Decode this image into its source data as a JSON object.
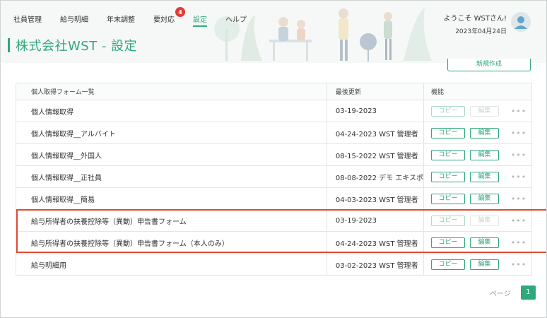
{
  "nav": {
    "items": [
      {
        "label": "社員管理"
      },
      {
        "label": "給与明細"
      },
      {
        "label": "年末調整"
      },
      {
        "label": "要対応",
        "badge": "4"
      },
      {
        "label": "設定",
        "active": true
      },
      {
        "label": "ヘルプ"
      }
    ]
  },
  "user": {
    "welcome": "ようこそ WSTさん!",
    "date": "2023年04月24日"
  },
  "page": {
    "title": "株式会社WST - 設定",
    "new_button": "新規作成"
  },
  "table": {
    "headers": {
      "name": "個人取得フォーム一覧",
      "updated": "最後更新",
      "function": "機能"
    },
    "copy_label": "コピー",
    "edit_label": "編集",
    "more_label": "•••",
    "rows": [
      {
        "name": "個人情報取得",
        "updated": "03-19-2023",
        "edit_disabled": true
      },
      {
        "name": "個人情報取得__アルバイト",
        "updated": "04-24-2023 WST 管理者",
        "edit_disabled": false
      },
      {
        "name": "個人情報取得__外国人",
        "updated": "08-15-2022 WST 管理者",
        "edit_disabled": false
      },
      {
        "name": "個人情報取得__正社員",
        "updated": "08-08-2022 デモ エキスポ",
        "edit_disabled": false
      },
      {
        "name": "個人情報取得__簡易",
        "updated": "04-03-2023 WST 管理者",
        "edit_disabled": false
      },
      {
        "name": "給与所得者の扶養控除等（異動）申告書フォーム",
        "updated": "03-19-2023",
        "edit_disabled": true
      },
      {
        "name": "給与所得者の扶養控除等（異動）申告書フォーム（本人のみ）",
        "updated": "04-24-2023 WST 管理者",
        "edit_disabled": false
      },
      {
        "name": "給与明細用",
        "updated": "03-02-2023 WST 管理者",
        "edit_disabled": false
      }
    ]
  },
  "pager": {
    "label": "ページ",
    "current": "1"
  },
  "colors": {
    "accent": "#2fa87a",
    "badge": "#e53935",
    "highlight": "#e04b35"
  }
}
